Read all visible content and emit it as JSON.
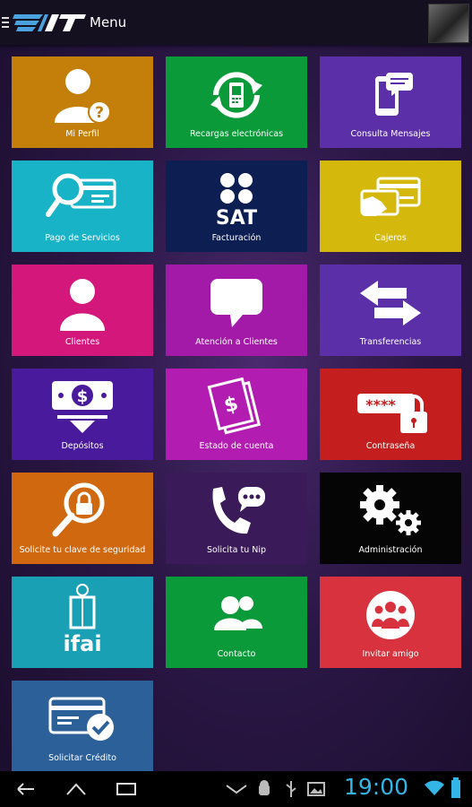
{
  "header": {
    "title": "Menu",
    "logo_text": "IT"
  },
  "tiles": [
    {
      "label": "Mi Perfil",
      "color": "#c47f0a",
      "icon": "profile-question-icon"
    },
    {
      "label": "Recargas electrónicas",
      "color": "#0a9a3a",
      "icon": "phone-refresh-icon"
    },
    {
      "label": "Consulta Mensajes",
      "color": "#5b2fa8",
      "icon": "phone-message-icon"
    },
    {
      "label": "Pago de Servicios",
      "color": "#19b3c8",
      "icon": "card-search-icon"
    },
    {
      "label": "Facturación",
      "color": "#0d1e52",
      "icon": "sat-logo-icon"
    },
    {
      "label": "Cajeros",
      "color": "#d4b80c",
      "icon": "card-hand-icon"
    },
    {
      "label": "Clientes",
      "color": "#d4177a",
      "icon": "user-icon"
    },
    {
      "label": "Atención a Clientes",
      "color": "#a31aa8",
      "icon": "speech-bubble-icon"
    },
    {
      "label": "Transferencias",
      "color": "#5b2fa8",
      "icon": "arrows-exchange-icon"
    },
    {
      "label": "Depósitos",
      "color": "#4a1a9c",
      "icon": "deposit-icon"
    },
    {
      "label": "Estado de cuenta",
      "color": "#b21cb0",
      "icon": "statement-icon"
    },
    {
      "label": "Contraseña",
      "color": "#c41e1e",
      "icon": "password-lock-icon"
    },
    {
      "label": "Solicite tu clave de seguridad",
      "color": "#d06810",
      "icon": "lock-search-icon"
    },
    {
      "label": "Solicita tu Nip",
      "color": "#3a1a58",
      "icon": "phone-chat-icon"
    },
    {
      "label": "Administración",
      "color": "#050505",
      "icon": "gears-icon"
    },
    {
      "label": "",
      "color": "#1aa0b4",
      "icon": "ifai-logo-icon",
      "logo_text": "ifai"
    },
    {
      "label": "Contacto",
      "color": "#0a9a3a",
      "icon": "contacts-icon"
    },
    {
      "label": "Invitar amigo",
      "color": "#d8323e",
      "icon": "group-invite-icon"
    },
    {
      "label": "Solicitar Crédito",
      "color": "#2c6098",
      "icon": "credit-card-check-icon"
    }
  ],
  "statusbar": {
    "time": "19:00",
    "accent": "#33b5e5"
  }
}
